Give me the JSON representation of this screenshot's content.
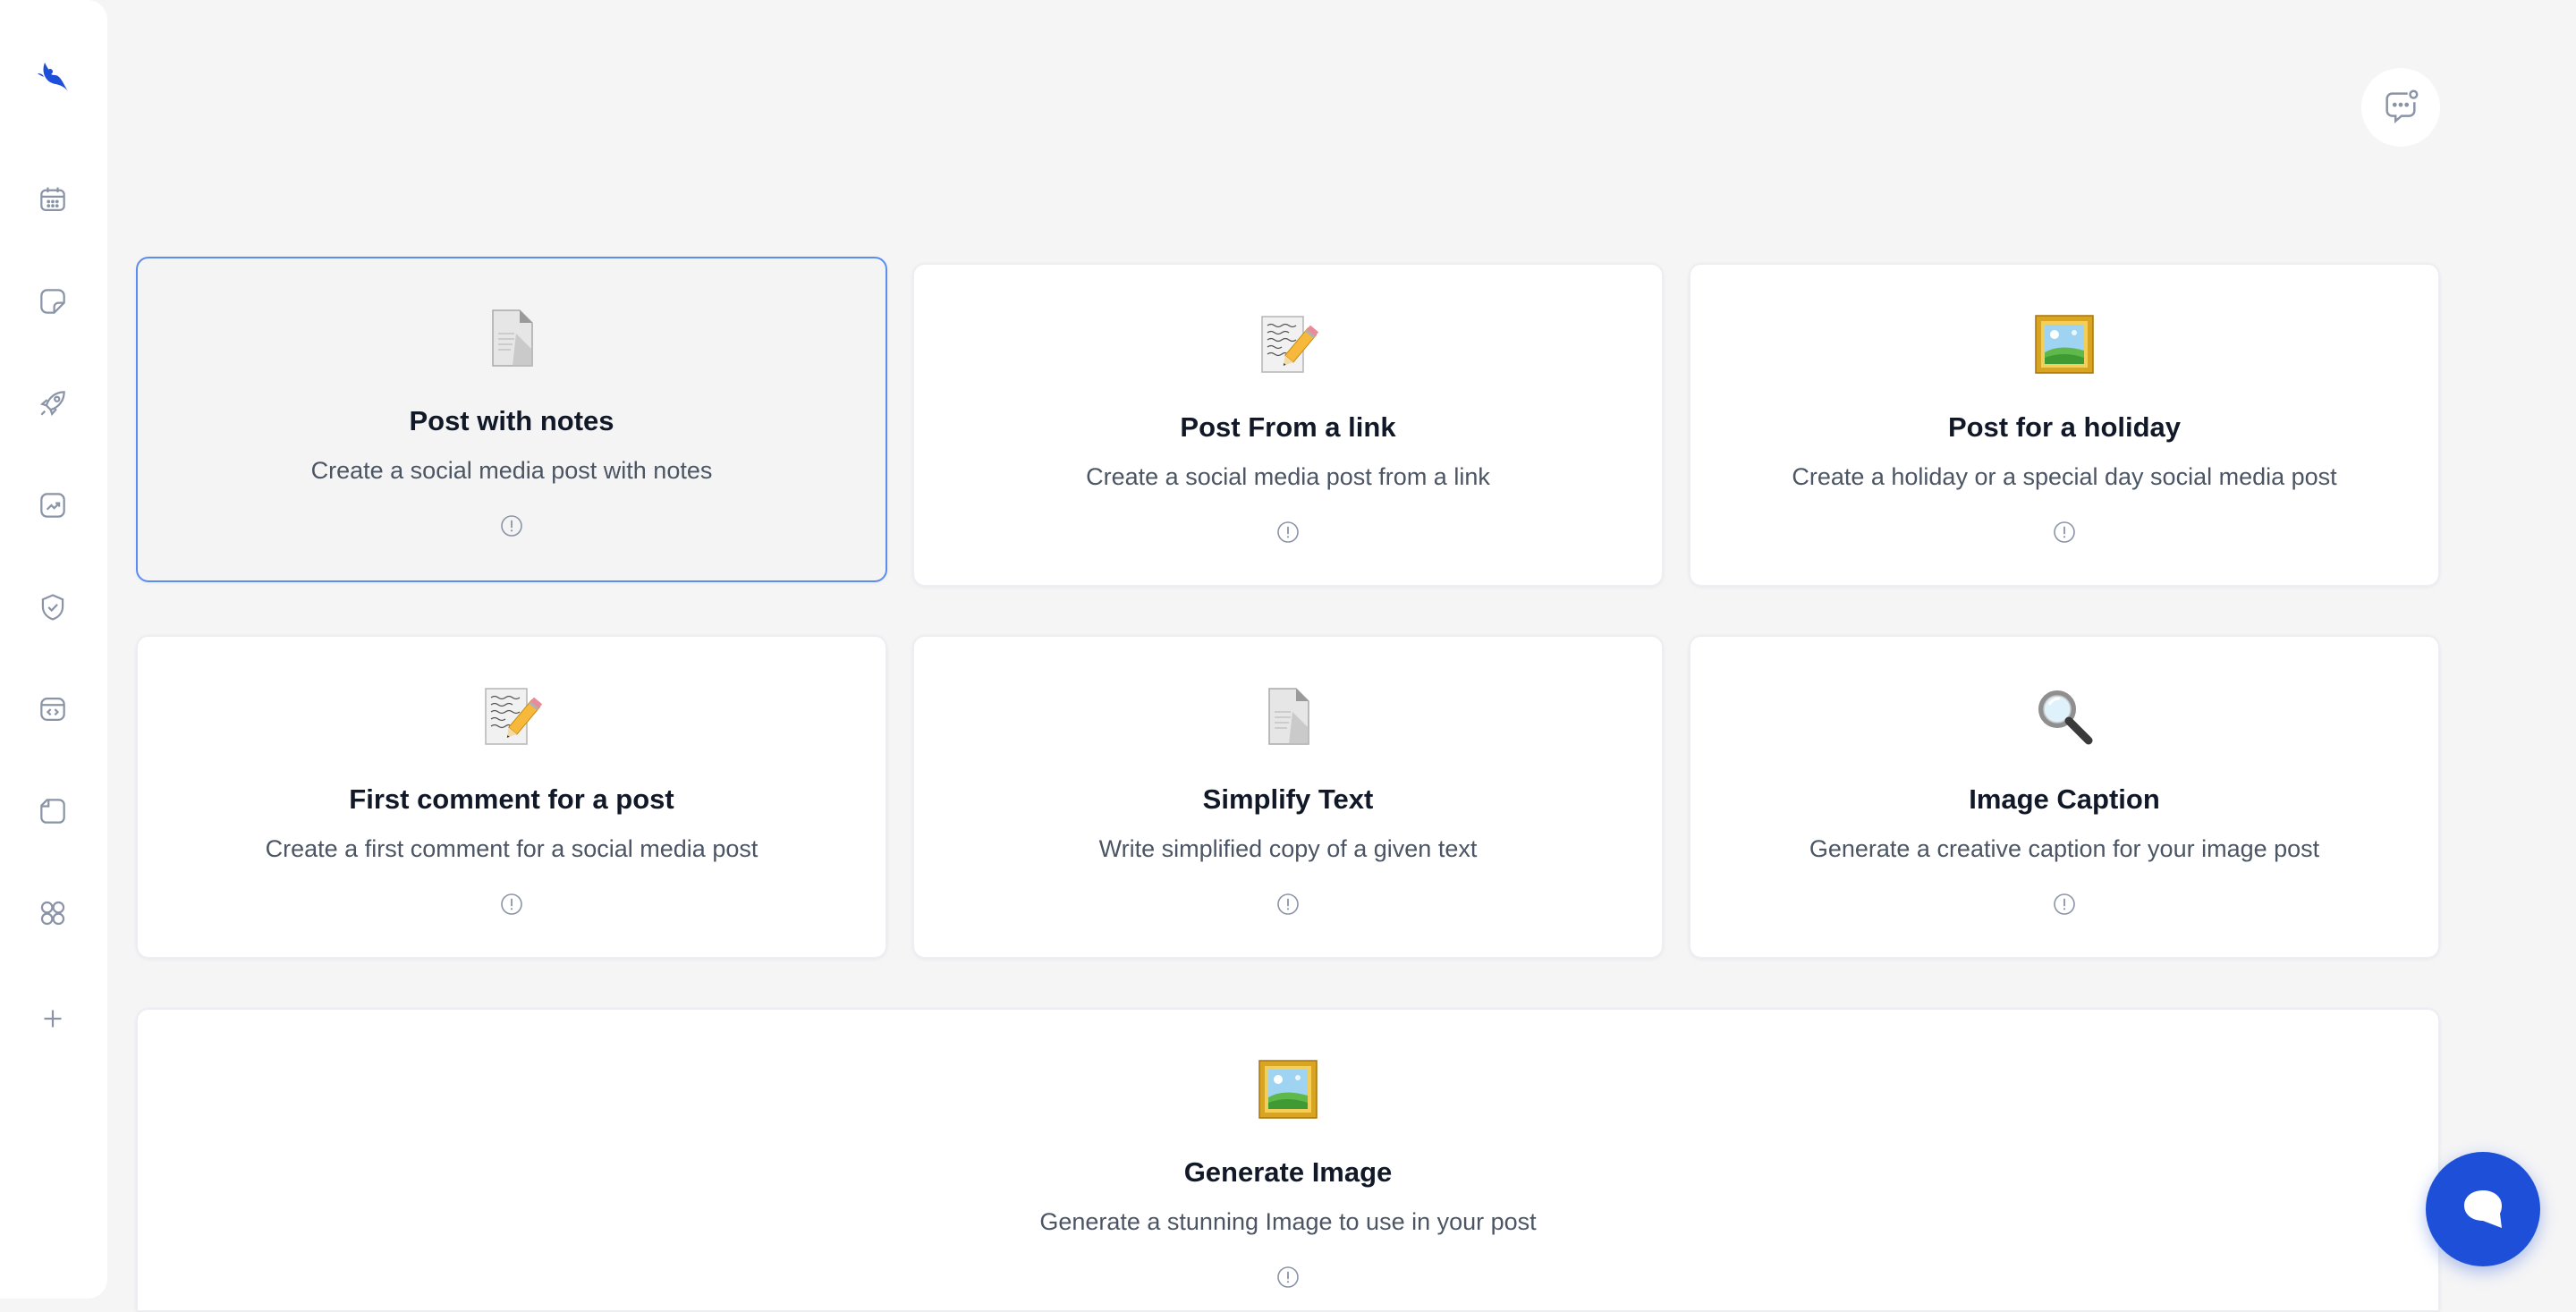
{
  "app": {
    "brand_color": "#1d4fd8"
  },
  "sidebar": {
    "items": [
      {
        "icon": "calendar-icon"
      },
      {
        "icon": "note-icon"
      },
      {
        "icon": "rocket-icon"
      },
      {
        "icon": "analytics-icon"
      },
      {
        "icon": "shield-check-icon"
      },
      {
        "icon": "code-window-icon"
      },
      {
        "icon": "folder-icon"
      },
      {
        "icon": "apps-grid-icon"
      },
      {
        "icon": "plus-icon"
      }
    ]
  },
  "cards": [
    {
      "emoji": "page-icon",
      "title": "Post with notes",
      "desc": "Create a social media post with notes",
      "selected": true
    },
    {
      "emoji": "memo-icon",
      "title": "Post From a link",
      "desc": "Create a social media post from a link"
    },
    {
      "emoji": "picture-icon",
      "title": "Post for a holiday",
      "desc": "Create a holiday or a special day social media post"
    },
    {
      "emoji": "memo-icon",
      "title": "First comment for a post",
      "desc": "Create a first comment for a social media post"
    },
    {
      "emoji": "page-icon",
      "title": "Simplify Text",
      "desc": "Write simplified copy of a given text"
    },
    {
      "emoji": "magnifier-icon",
      "title": "Image Caption",
      "desc": "Generate a creative caption for your image post"
    },
    {
      "emoji": "picture-icon",
      "title": "Generate Image",
      "desc": "Generate a stunning Image to use in your post"
    }
  ]
}
